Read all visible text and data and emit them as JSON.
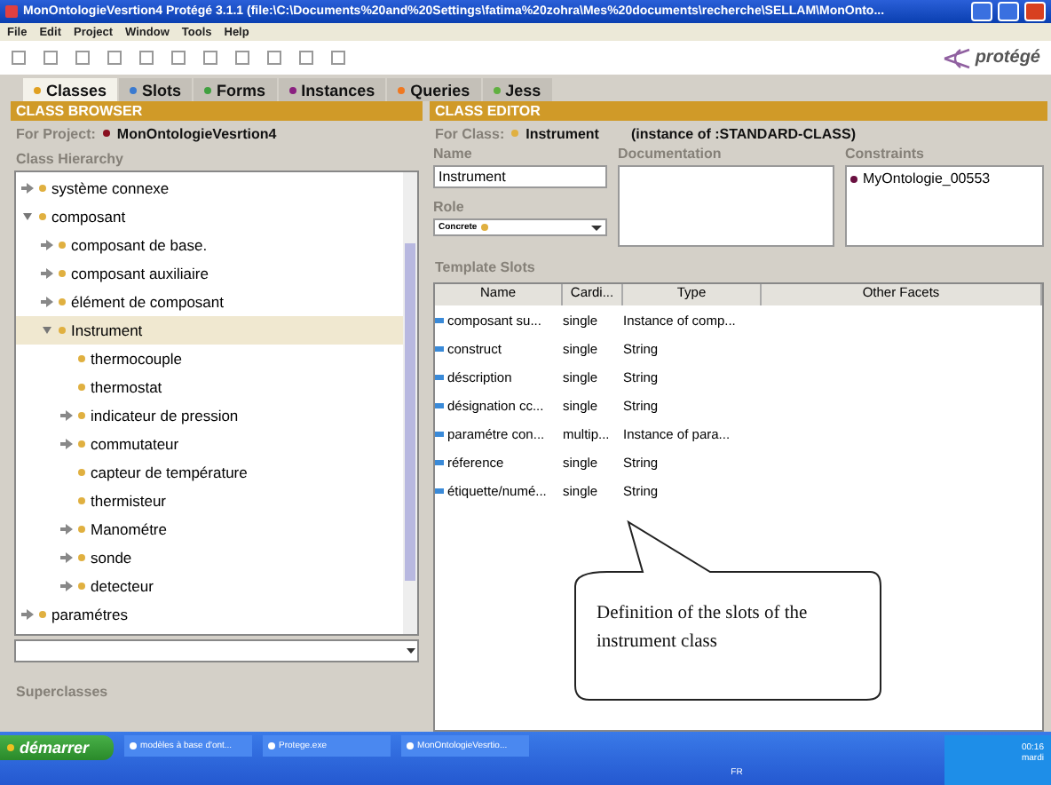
{
  "window": {
    "title": "MonOntologieVesrtion4  Protégé 3.1.1     (file:\\C:\\Documents%20and%20Settings\\fatima%20zohra\\Mes%20documents\\recherche\\SELLAM\\MonOnto..."
  },
  "menu": [
    "File",
    "Edit",
    "Project",
    "Window",
    "Tools",
    "Help"
  ],
  "logo": "protégé",
  "tabs": [
    {
      "label": "Classes",
      "selected": true,
      "color": "#e0a020"
    },
    {
      "label": "Slots",
      "selected": false,
      "color": "#3a7ad0"
    },
    {
      "label": "Forms",
      "selected": false,
      "color": "#40a040"
    },
    {
      "label": "Instances",
      "selected": false,
      "color": "#8a2080"
    },
    {
      "label": "Queries",
      "selected": false,
      "color": "#f07820"
    },
    {
      "label": "Jess",
      "selected": false,
      "color": "#60b040"
    }
  ],
  "class_browser": {
    "header": "CLASS BROWSER",
    "project_label": "For Project:",
    "project": "MonOntologieVesrtion4",
    "hierarchy_label": "Class Hierarchy",
    "tree": [
      {
        "label": "système connexe",
        "kind": "branch",
        "expanded": false,
        "selected": false
      },
      {
        "label": "composant",
        "kind": "branch",
        "expanded": true,
        "selected": false,
        "children": [
          {
            "label": "composant de base.",
            "kind": "branch",
            "expanded": false,
            "selected": false
          },
          {
            "label": "composant auxiliaire",
            "kind": "branch",
            "expanded": false,
            "selected": false
          },
          {
            "label": "élément de composant",
            "kind": "branch",
            "expanded": false,
            "selected": false
          },
          {
            "label": "Instrument",
            "kind": "branch",
            "expanded": true,
            "selected": true,
            "children": [
              {
                "label": "thermocouple",
                "kind": "leaf",
                "selected": false
              },
              {
                "label": "thermostat",
                "kind": "leaf",
                "selected": false
              },
              {
                "label": "indicateur de pression",
                "kind": "branch",
                "expanded": false,
                "selected": false
              },
              {
                "label": "commutateur",
                "kind": "branch",
                "expanded": false,
                "selected": false
              },
              {
                "label": "capteur de température",
                "kind": "leaf",
                "selected": false
              },
              {
                "label": "thermisteur",
                "kind": "leaf",
                "selected": false
              },
              {
                "label": "Manométre",
                "kind": "branch",
                "expanded": false,
                "selected": false
              },
              {
                "label": "sonde",
                "kind": "branch",
                "expanded": false,
                "selected": false
              },
              {
                "label": "detecteur",
                "kind": "branch",
                "expanded": false,
                "selected": false
              }
            ]
          }
        ]
      },
      {
        "label": "paramétres",
        "kind": "branch",
        "expanded": false,
        "selected": false
      }
    ],
    "superclasses_label": "Superclasses"
  },
  "class_editor": {
    "header": "CLASS EDITOR",
    "class_label": "For Class:",
    "class_name": "Instrument",
    "instance_of": "(instance of :STANDARD-CLASS)",
    "name_label": "Name",
    "name_value": "Instrument",
    "documentation_label": "Documentation",
    "constraints_label": "Constraints",
    "constraints": [
      "MyOntologie_00553"
    ],
    "role_label": "Role",
    "role_value": "Concrete",
    "template_slots_label": "Template Slots",
    "columns": [
      "Name",
      "Cardi...",
      "Type",
      "Other Facets"
    ],
    "rows": [
      {
        "name": "composant  su...",
        "cardinality": "single",
        "type": "Instance of comp..."
      },
      {
        "name": "construct",
        "cardinality": "single",
        "type": "String"
      },
      {
        "name": "déscription",
        "cardinality": "single",
        "type": "String"
      },
      {
        "name": "désignation cc...",
        "cardinality": "single",
        "type": "String"
      },
      {
        "name": "paramétre con...",
        "cardinality": "multip...",
        "type": "Instance of para..."
      },
      {
        "name": "réference",
        "cardinality": "single",
        "type": "String"
      },
      {
        "name": "étiquette/numé...",
        "cardinality": "single",
        "type": "String"
      }
    ]
  },
  "callout": "Definition of the slots of the instrument class",
  "taskbar": {
    "start": "démarrer",
    "tasks": [
      "modèles à base d'ont...",
      "Protege.exe",
      "MonOntologieVesrtio..."
    ],
    "language": "FR",
    "time": "00:16",
    "day": "mardi"
  }
}
